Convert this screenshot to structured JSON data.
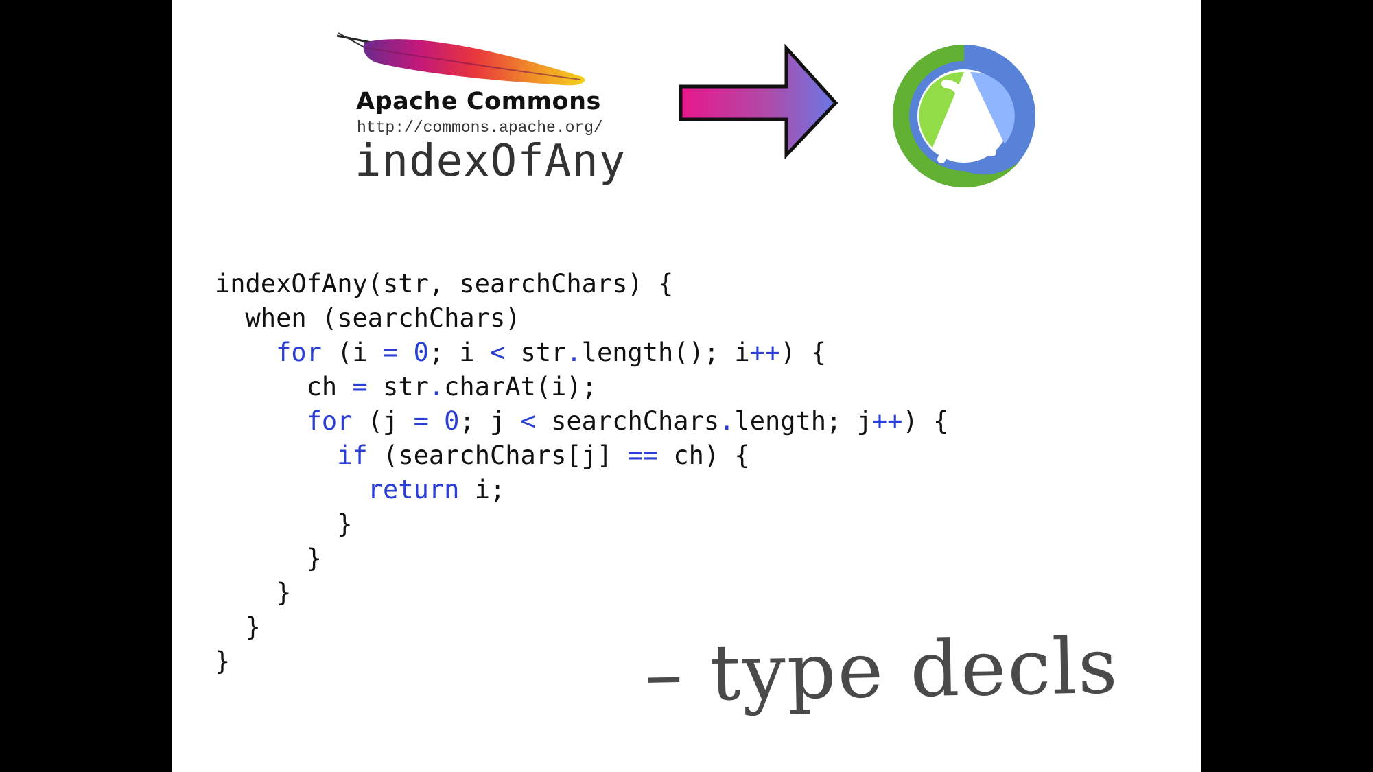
{
  "header": {
    "library_name": "Apache Commons",
    "library_url": "http://commons.apache.org/",
    "function_name": "indexOfAny"
  },
  "icons": {
    "left_logo": "apache-feather-icon",
    "arrow": "right-arrow-icon",
    "right_logo": "clojure-lambda-icon"
  },
  "colors": {
    "keyword": "#2b3fd6",
    "text": "#111111",
    "annotation": "#4a4a4a",
    "arrow_start": "#e8178b",
    "arrow_end": "#6a78e6",
    "clojure_green": "#63b132",
    "clojure_blue": "#5881d8"
  },
  "code": {
    "lines": [
      [
        {
          "t": "indexOfAny(str, searchChars) {"
        }
      ],
      [
        {
          "t": "  when (searchChars)"
        }
      ],
      [
        {
          "t": "    "
        },
        {
          "t": "for",
          "kw": true
        },
        {
          "t": " (i "
        },
        {
          "t": "=",
          "kw": true
        },
        {
          "t": " "
        },
        {
          "t": "0",
          "kw": true
        },
        {
          "t": "; i "
        },
        {
          "t": "<",
          "kw": true
        },
        {
          "t": " str"
        },
        {
          "t": ".",
          "kw": true
        },
        {
          "t": "length(); i"
        },
        {
          "t": "++",
          "kw": true
        },
        {
          "t": ") {"
        }
      ],
      [
        {
          "t": "      ch "
        },
        {
          "t": "=",
          "kw": true
        },
        {
          "t": " str"
        },
        {
          "t": ".",
          "kw": true
        },
        {
          "t": "charAt(i);"
        }
      ],
      [
        {
          "t": "      "
        },
        {
          "t": "for",
          "kw": true
        },
        {
          "t": " (j "
        },
        {
          "t": "=",
          "kw": true
        },
        {
          "t": " "
        },
        {
          "t": "0",
          "kw": true
        },
        {
          "t": "; j "
        },
        {
          "t": "<",
          "kw": true
        },
        {
          "t": " searchChars"
        },
        {
          "t": ".",
          "kw": true
        },
        {
          "t": "length; j"
        },
        {
          "t": "++",
          "kw": true
        },
        {
          "t": ") {"
        }
      ],
      [
        {
          "t": "        "
        },
        {
          "t": "if",
          "kw": true
        },
        {
          "t": " (searchChars[j] "
        },
        {
          "t": "==",
          "kw": true
        },
        {
          "t": " ch) {"
        }
      ],
      [
        {
          "t": "          "
        },
        {
          "t": "return",
          "kw": true
        },
        {
          "t": " i;"
        }
      ],
      [
        {
          "t": "        }"
        }
      ],
      [
        {
          "t": "      }"
        }
      ],
      [
        {
          "t": "    }"
        }
      ],
      [
        {
          "t": "  }"
        }
      ],
      [
        {
          "t": "}"
        }
      ]
    ]
  },
  "annotation": {
    "text": "– type decls"
  }
}
